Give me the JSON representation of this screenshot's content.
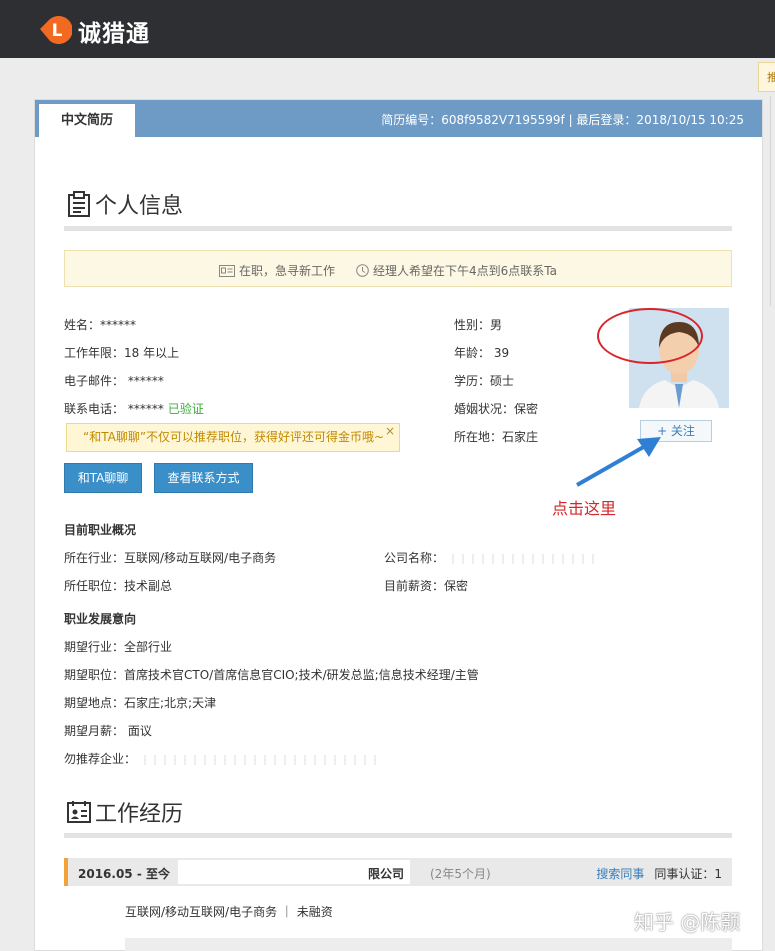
{
  "app": {
    "brand_name": "诚猎通",
    "logo_letter": "L",
    "side_tab_text": "推"
  },
  "resume": {
    "tab_label": "中文简历",
    "meta_text": "简历编号：608f9582V7195599f | 最后登录：2018/10/15 10:25"
  },
  "personal": {
    "section_title": "个人信息",
    "status_text": "在职，急寻新工作",
    "contact_hint": "经理人希望在下午4点到6点联系Ta",
    "name": "姓名：******",
    "experience": "工作年限：18 年以上",
    "email": "电子邮件： ******",
    "phone": "联系电话： ******",
    "phone_verified": "已验证",
    "gender": "性别：男",
    "age": "年龄： 39",
    "education": "学历：硕士",
    "marital": "婚姻状况：保密",
    "location": "所在地：石家庄",
    "tooltip": "“和TA聊聊”不仅可以推荐职位，获得好评还可得金币哦~",
    "tooltip_close": "×",
    "chat_button": "和TA聊聊",
    "contact_button": "查看联系方式",
    "follow_button": "+ 关注"
  },
  "current_job": {
    "title": "目前职业概况",
    "industry": "所在行业：互联网/移动互联网/电子商务",
    "position": "所任职位：技术副总",
    "company_label": "公司名称：",
    "salary": "目前薪资：保密"
  },
  "intention": {
    "title": "职业发展意向",
    "industry": "期望行业：全部行业",
    "position": "期望职位：首席技术官CTO/首席信息官CIO;技术/研发总监;信息技术经理/主管",
    "location": "期望地点：石家庄;北京;天津",
    "salary": "期望月薪： 面议",
    "exclude": "勿推荐企业："
  },
  "work": {
    "section_title": "工作经历",
    "date": "2016.05 - 至今",
    "company_suffix": "限公司",
    "duration": "(2年5个月)",
    "search_colleague": "搜索同事",
    "colleague_cert": "同事认证：1",
    "tags": "互联网/移动互联网/电子商务 ｜ 未融资"
  },
  "annotation": {
    "text": "点击这里"
  },
  "watermark": {
    "text": "知乎 @陈颢"
  },
  "colors": {
    "topbar": "#2e2f33",
    "header_blue": "#6d9bc6",
    "button_blue": "#3a8fc8",
    "verified_green": "#3ea93e",
    "annotation_red": "#d8252b",
    "logo_orange": "#f26a21"
  }
}
